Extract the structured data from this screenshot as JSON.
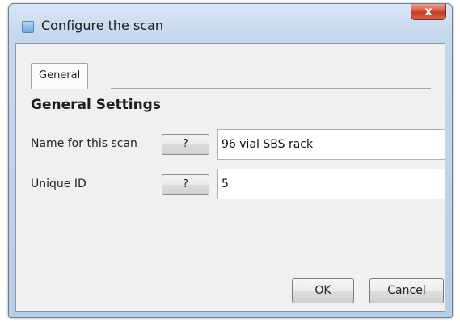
{
  "window": {
    "title": "Configure the scan",
    "close_glyph": "x"
  },
  "tabs": [
    {
      "label": "General",
      "selected": true
    }
  ],
  "section": {
    "title": "General Settings"
  },
  "fields": [
    {
      "label": "Name for this scan",
      "help_label": "?",
      "value": "96 vial SBS rack"
    },
    {
      "label": "Unique ID",
      "help_label": "?",
      "value": "5"
    }
  ],
  "buttons": {
    "ok": "OK",
    "cancel": "Cancel"
  },
  "colors": {
    "title_bar": "#c6d8ee",
    "close_button": "#c23d26",
    "client_bg": "#f0f0f0"
  },
  "icons": {
    "app": "window-app-icon",
    "close": "close-icon"
  }
}
